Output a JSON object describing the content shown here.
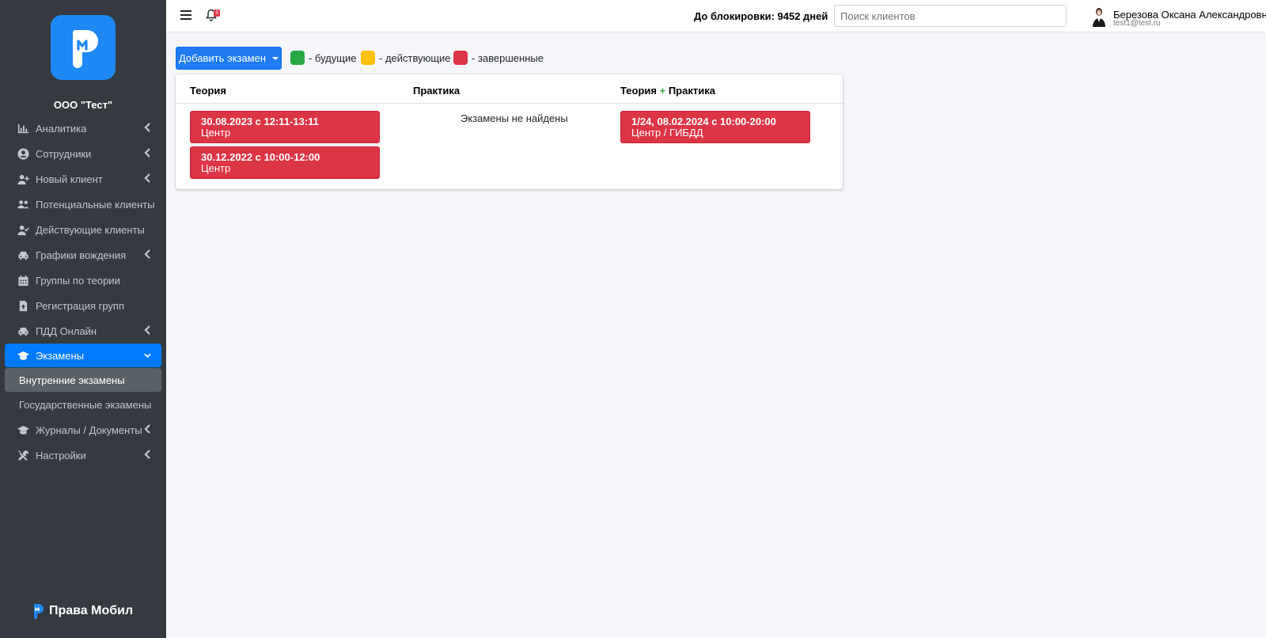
{
  "sidebar": {
    "company": "ООО \"Тест\"",
    "items": [
      {
        "label": "Аналитика",
        "icon": "chart-icon",
        "chevron": "left"
      },
      {
        "label": "Сотрудники",
        "icon": "user-circle-icon",
        "chevron": "left"
      },
      {
        "label": "Новый клиент",
        "icon": "user-plus-icon",
        "chevron": "left"
      },
      {
        "label": "Потенциальные клиенты",
        "icon": "users-icon"
      },
      {
        "label": "Действующие клиенты",
        "icon": "user-check-icon"
      },
      {
        "label": "Графики вождения",
        "icon": "car-icon",
        "chevron": "left"
      },
      {
        "label": "Группы по теории",
        "icon": "calendar-icon"
      },
      {
        "label": "Регистрация групп",
        "icon": "file-upload-icon"
      },
      {
        "label": "ПДД Онлайн",
        "icon": "car-icon",
        "chevron": "left"
      },
      {
        "label": "Экзамены",
        "icon": "graduation-cap-icon",
        "chevron": "down",
        "active": true
      },
      {
        "label": "Журналы / Документы",
        "icon": "graduation-cap-icon",
        "chevron": "left"
      },
      {
        "label": "Настройки",
        "icon": "tools-icon",
        "chevron": "left"
      }
    ],
    "subitems": [
      {
        "label": "Внутренние экзамены",
        "selected": true
      },
      {
        "label": "Государственные экзамены"
      }
    ],
    "brand": "Права Мобил"
  },
  "topbar": {
    "notification_count": "3",
    "blocking_text": "До блокировки: 9452 дней",
    "search_placeholder": "Поиск клиентов",
    "user_name": "Березова Оксана Александровна",
    "user_email": "test1@test.ru"
  },
  "toolbar": {
    "add_exam_label": "Добавить экзамен",
    "legend": [
      {
        "label": "- будущие",
        "color": "#28a745"
      },
      {
        "label": "- действующие",
        "color": "#ffc107"
      },
      {
        "label": "- завершенные",
        "color": "#dc3545"
      }
    ]
  },
  "table": {
    "headers": {
      "theory": "Теория",
      "practice": "Практика",
      "combined_a": "Теория",
      "combined_plus": "+",
      "combined_b": "Практика"
    },
    "theory_exams": [
      {
        "date": "30.08.2023 с 12:11-13:11",
        "place": "Центр",
        "color": "#dc3545"
      },
      {
        "date": "30.12.2022 с 10:00-12:00",
        "place": "Центр",
        "color": "#dc3545"
      }
    ],
    "practice_empty": "Экзамены не найдены",
    "combined_exams": [
      {
        "date": "1/24, 08.02.2024 с 10:00-20:00",
        "place": "Центр / ГИБДД",
        "color": "#dc3545"
      }
    ]
  }
}
